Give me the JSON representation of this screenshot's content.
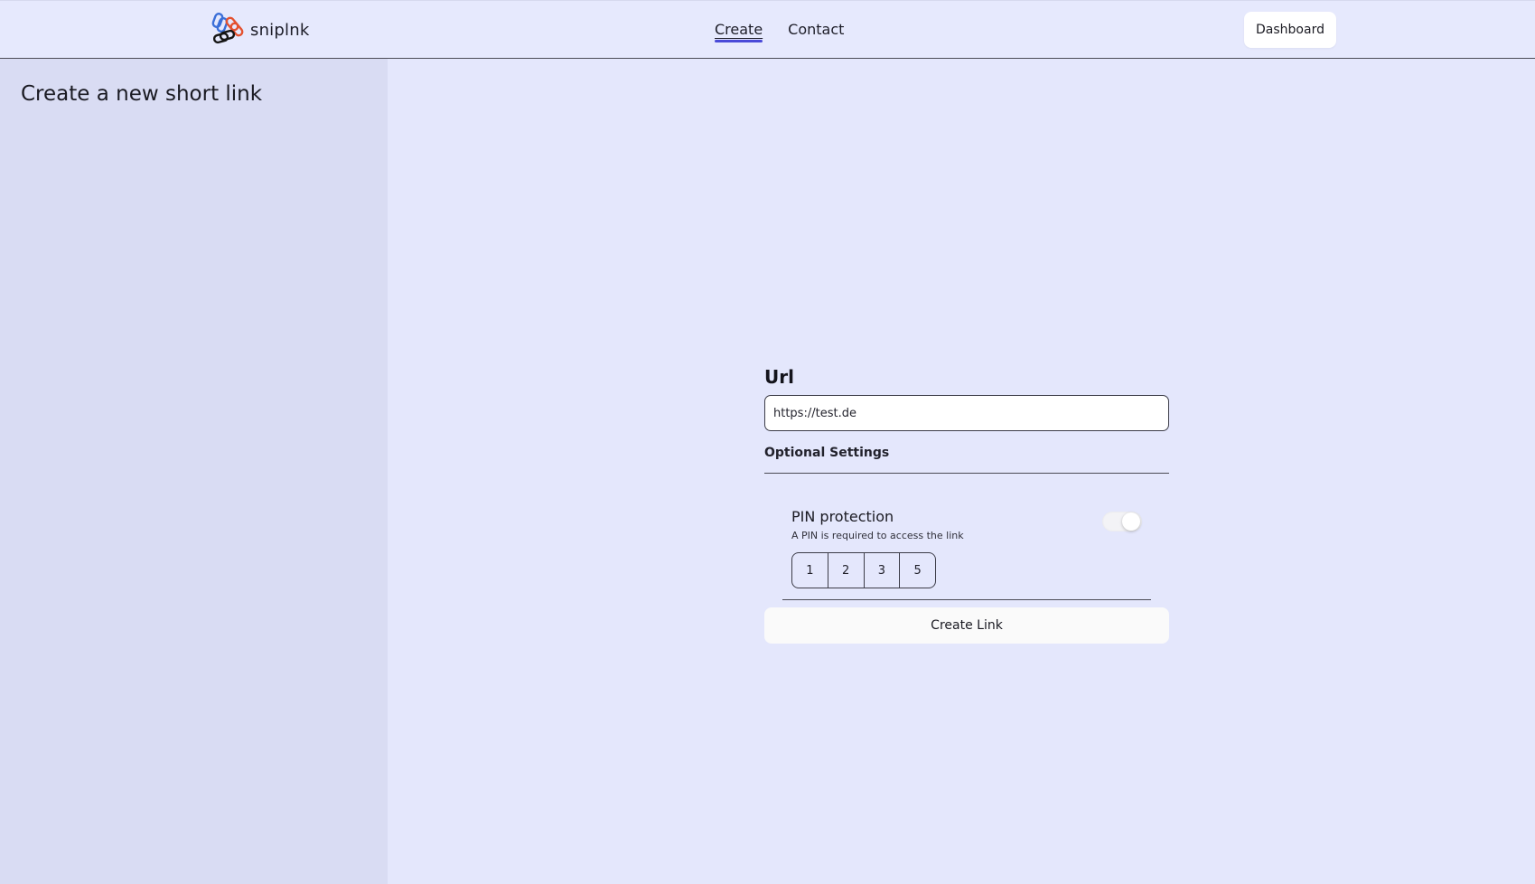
{
  "brand": {
    "name": "sniplnk",
    "logo_icon": "chain-link-icon",
    "colors": {
      "blue": "#3b6fd8",
      "red": "#e4512f",
      "black": "#151515"
    }
  },
  "nav": {
    "items": [
      {
        "label": "Create",
        "active": true
      },
      {
        "label": "Contact",
        "active": false
      }
    ]
  },
  "header": {
    "dashboard_label": "Dashboard"
  },
  "sidebar": {
    "title": "Create a new short link"
  },
  "form": {
    "url_label": "Url",
    "url_value": "https://test.de",
    "optional_settings_label": "Optional Settings",
    "pin": {
      "title": "PIN protection",
      "description": "A PIN is required to access the link",
      "enabled": true,
      "digits": [
        "1",
        "2",
        "3",
        "5"
      ]
    },
    "submit_label": "Create Link"
  },
  "colors": {
    "page_bg": "#e4e7fc",
    "sidebar_bg": "#d9dcf3",
    "nav_active_underline": "#4a4ad8"
  }
}
